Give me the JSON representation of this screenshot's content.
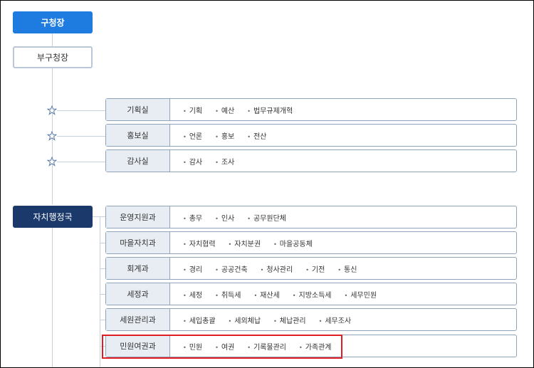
{
  "top": {
    "mayor": "구청장",
    "deputy": "부구청장",
    "bureau": "자치행정국"
  },
  "offices": [
    {
      "name": "기획실",
      "tasks": [
        "기획",
        "예산",
        "법무규제개혁"
      ]
    },
    {
      "name": "홍보실",
      "tasks": [
        "언론",
        "홍보",
        "전산"
      ]
    },
    {
      "name": "감사실",
      "tasks": [
        "감사",
        "조사"
      ]
    }
  ],
  "bureau_depts": [
    {
      "name": "운영지원과",
      "tasks": [
        "총무",
        "인사",
        "공무원단체"
      ]
    },
    {
      "name": "마을자치과",
      "tasks": [
        "자치협력",
        "자치분권",
        "마을공동체"
      ]
    },
    {
      "name": "회계과",
      "tasks": [
        "경리",
        "공공건축",
        "청사관리",
        "기전",
        "통신"
      ]
    },
    {
      "name": "세정과",
      "tasks": [
        "세정",
        "취득세",
        "재산세",
        "지방소득세",
        "세무민원"
      ]
    },
    {
      "name": "세원관리과",
      "tasks": [
        "세입총괄",
        "세외체납",
        "체납관리",
        "세무조사"
      ]
    },
    {
      "name": "민원여권과",
      "tasks": [
        "민원",
        "여권",
        "기록물관리",
        "가족관계"
      ]
    }
  ],
  "colors": {
    "mayor_bg": "#1e7be0",
    "bureau_bg": "#1b3a6b",
    "highlight": "#e11d24"
  }
}
